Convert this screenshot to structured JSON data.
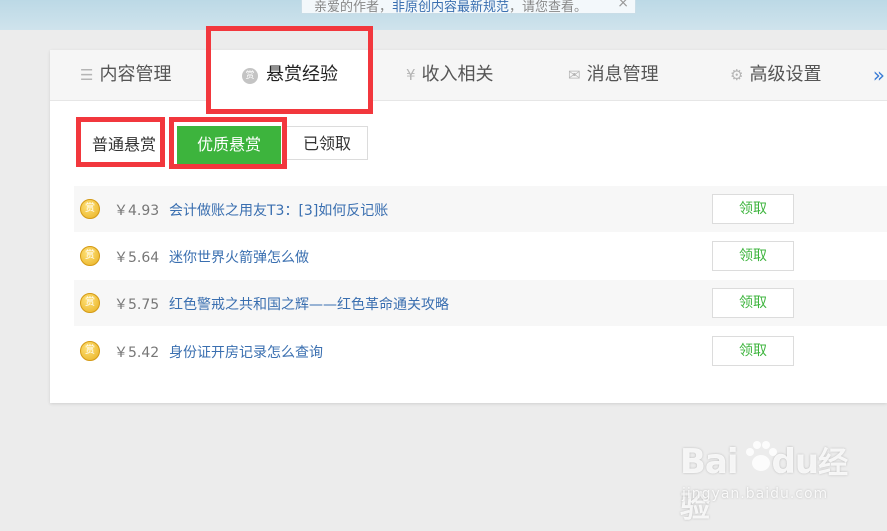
{
  "notice": {
    "prefix": "亲爱的作者，",
    "link": "非原创内容最新规范",
    "suffix": "，请您查看。",
    "close": "×"
  },
  "tabs": [
    {
      "label": "内容管理",
      "icon": "list-icon"
    },
    {
      "label": "悬赏经验",
      "icon": "coin-icon",
      "icon_char": "赏"
    },
    {
      "label": "收入相关",
      "icon": "yen-icon"
    },
    {
      "label": "消息管理",
      "icon": "mail-icon"
    },
    {
      "label": "高级设置",
      "icon": "gear-icon"
    }
  ],
  "more": "»",
  "subtabs": [
    {
      "label": "普通悬赏"
    },
    {
      "label": "优质悬赏"
    },
    {
      "label": "已领取"
    }
  ],
  "rows": [
    {
      "coin": "赏",
      "amount": "￥4.93",
      "title": "会计做账之用友T3：[3]如何反记账",
      "action": "领取"
    },
    {
      "coin": "赏",
      "amount": "￥5.64",
      "title": "迷你世界火箭弹怎么做",
      "action": "领取"
    },
    {
      "coin": "赏",
      "amount": "￥5.75",
      "title": "红色警戒之共和国之辉——红色革命通关攻略",
      "action": "领取"
    },
    {
      "coin": "赏",
      "amount": "￥5.42",
      "title": "身份证开房记录怎么查询",
      "action": "领取"
    }
  ],
  "watermark": {
    "brand_a": "Bai",
    "brand_b": "du",
    "brand_c": "经验",
    "url": "jingyan.baidu.com"
  },
  "colors": {
    "accent_green": "#3db43d",
    "highlight_red": "#f2373d",
    "link_blue": "#3a6fb0"
  }
}
